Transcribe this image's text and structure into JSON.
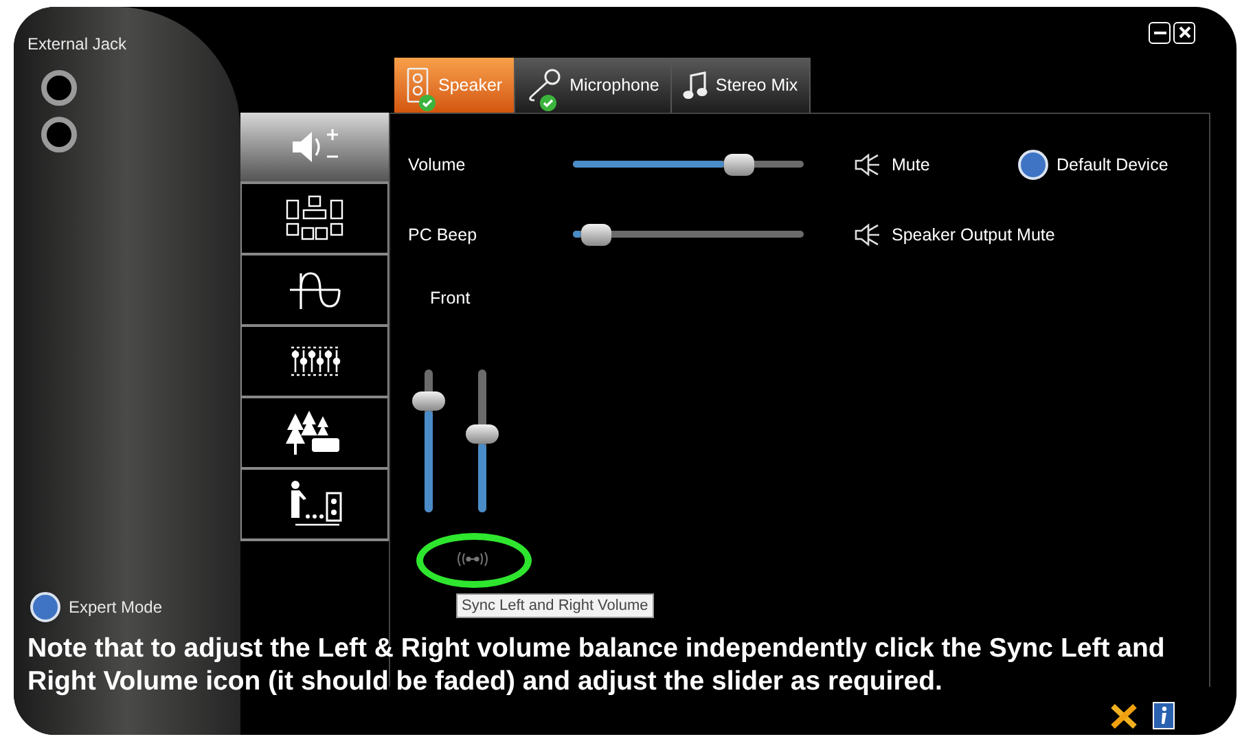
{
  "left_panel": {
    "title": "External Jack",
    "expert_mode": {
      "label": "Expert Mode",
      "selected": true
    }
  },
  "tabs": [
    {
      "label": "Speaker",
      "kind": "speaker",
      "selected": true,
      "default_check": true
    },
    {
      "label": "Microphone",
      "kind": "microphone",
      "selected": false,
      "default_check": true
    },
    {
      "label": "Stereo Mix",
      "kind": "music",
      "selected": false,
      "default_check": false
    }
  ],
  "side_nav": [
    {
      "kind": "volume",
      "selected": true
    },
    {
      "kind": "speakers",
      "selected": false
    },
    {
      "kind": "wave",
      "selected": false
    },
    {
      "kind": "equalizer",
      "selected": false
    },
    {
      "kind": "environment",
      "selected": false
    },
    {
      "kind": "distance",
      "selected": false
    }
  ],
  "sliders": [
    {
      "label": "Volume",
      "level": 0.72,
      "mute": "Mute"
    },
    {
      "label": "PC Beep",
      "level": 0.1,
      "mute": "Speaker Output Mute"
    }
  ],
  "default_device": {
    "label": "Default Device",
    "selected": true
  },
  "front": {
    "label": "Front",
    "left": {
      "level": 0.78
    },
    "right": {
      "level": 0.55
    }
  },
  "tooltip": "Sync Left and Right Volume",
  "note": "Note that to adjust the Left & Right volume balance independently click the Sync Left and Right Volume icon (it should be faded) and adjust the slider as required."
}
